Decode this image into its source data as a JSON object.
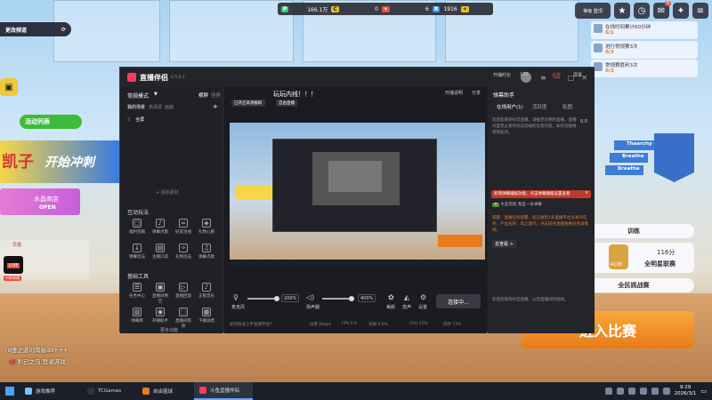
{
  "game": {
    "channel_label": "更改频道",
    "stat1": "166.1万",
    "stat2": "0",
    "stat3": "6",
    "stat4": "1916",
    "activity_list": "活动列表",
    "promo_big": "开始冲刺",
    "promo_left": "凯子",
    "shop_name": "水晶商店",
    "shop_status": "OPEN",
    "live_badge": "LIVE",
    "live_sub": "0系缺席",
    "news_label": "早报",
    "level_label": "等级\n登顶",
    "badge_count": "8",
    "tasks": [
      {
        "title": "在线时间累计60分钟",
        "progress": "0/1",
        "sub": "60"
      },
      {
        "title": "进行常规赛3次",
        "progress": "0/3",
        "sub": "3"
      },
      {
        "title": "常规赛胜利3次",
        "progress": "0/3",
        "sub": "3"
      }
    ],
    "player_names": [
      "Thearchy",
      "Breathe",
      "Breathe"
    ],
    "train_label": "训练",
    "score_value": "116分",
    "score_title": "全明星联赛",
    "rank_badge": "4108",
    "all_challenge": "全民挑战赛",
    "enter_match": "进入比赛",
    "chat_user": "[0册之道0]简易dd+++",
    "chat_action": "利己之马 登录游戏"
  },
  "app": {
    "name": "直播伴侣",
    "version": "6.5.6.5",
    "mode": "常规模式",
    "mode_opts": [
      "横屏",
      "竖屏"
    ],
    "scene_tabs": [
      "我的场景",
      "高清源",
      "画面"
    ],
    "scene_item": "全屏",
    "add_source": "+ 添加素材",
    "interact_title": "互动玩法",
    "interact_items": [
      "福利宝箱",
      "弹幕点歌",
      "好友连线",
      "礼物心愿",
      "弹幕玩法",
      "主播口袋",
      "礼物连击",
      "弹幕点歌"
    ],
    "tools_title": "基础工具",
    "tools_items": [
      "任务中心",
      "直播间预告",
      "直播回放",
      "正版音乐",
      "弹幕库",
      "开播助手",
      "直播间装修",
      "下播总结"
    ],
    "more_btn": "更多功能",
    "preview_title": "玩玩内线！！！",
    "preview_tags": [
      "已开启高清截取",
      "自由直播"
    ],
    "top_actions": [
      "开播说明",
      "分享"
    ],
    "right_top": [
      "开播时长",
      "120",
      "设置",
      "屏幕"
    ],
    "assistant_title": "弹幕助手",
    "assistant_tabs": [
      "在线用户(1)",
      "活跃度",
      "贴图"
    ],
    "viewer_count": "0.0",
    "assistant_msgs": [
      "欢迎您来到抖音直播，请规范文明的直播。直播间里禁止发布违法违规的信息内容，如有违规将受到处罚。",
      "新增弹幕播报功能，点击弹幕播报设置查看",
      "水友黑粉  我是一条弹幕",
      "提醒：直播任务提醒，您已收到1条直播平台派发的任务，产品名称：风之旅行，点击前往直播查看任务详情吧。",
      "去查看 >",
      "欢迎您来到抖音直播，以及直播间的规则。"
    ],
    "mic_label": "麦克风",
    "mic_val": "200%",
    "speaker_label": "扬声器",
    "speaker_val": "400%",
    "bottom_btns": [
      "美颜",
      "变声",
      "设置"
    ],
    "live_btn": "连接中...",
    "status_bar": [
      "码率 0kbps",
      "FPS 0.0",
      "丢帧 0.0%",
      "CPU 11%",
      "内存 73%"
    ],
    "status_hint": "如何快速上手直播伴侣?"
  },
  "taskbar": {
    "items": [
      "游戏推荐",
      "TCGames",
      "自由篮球",
      "斗鱼直播伴侣"
    ],
    "time": "9:29",
    "date": "2026/3/1"
  }
}
